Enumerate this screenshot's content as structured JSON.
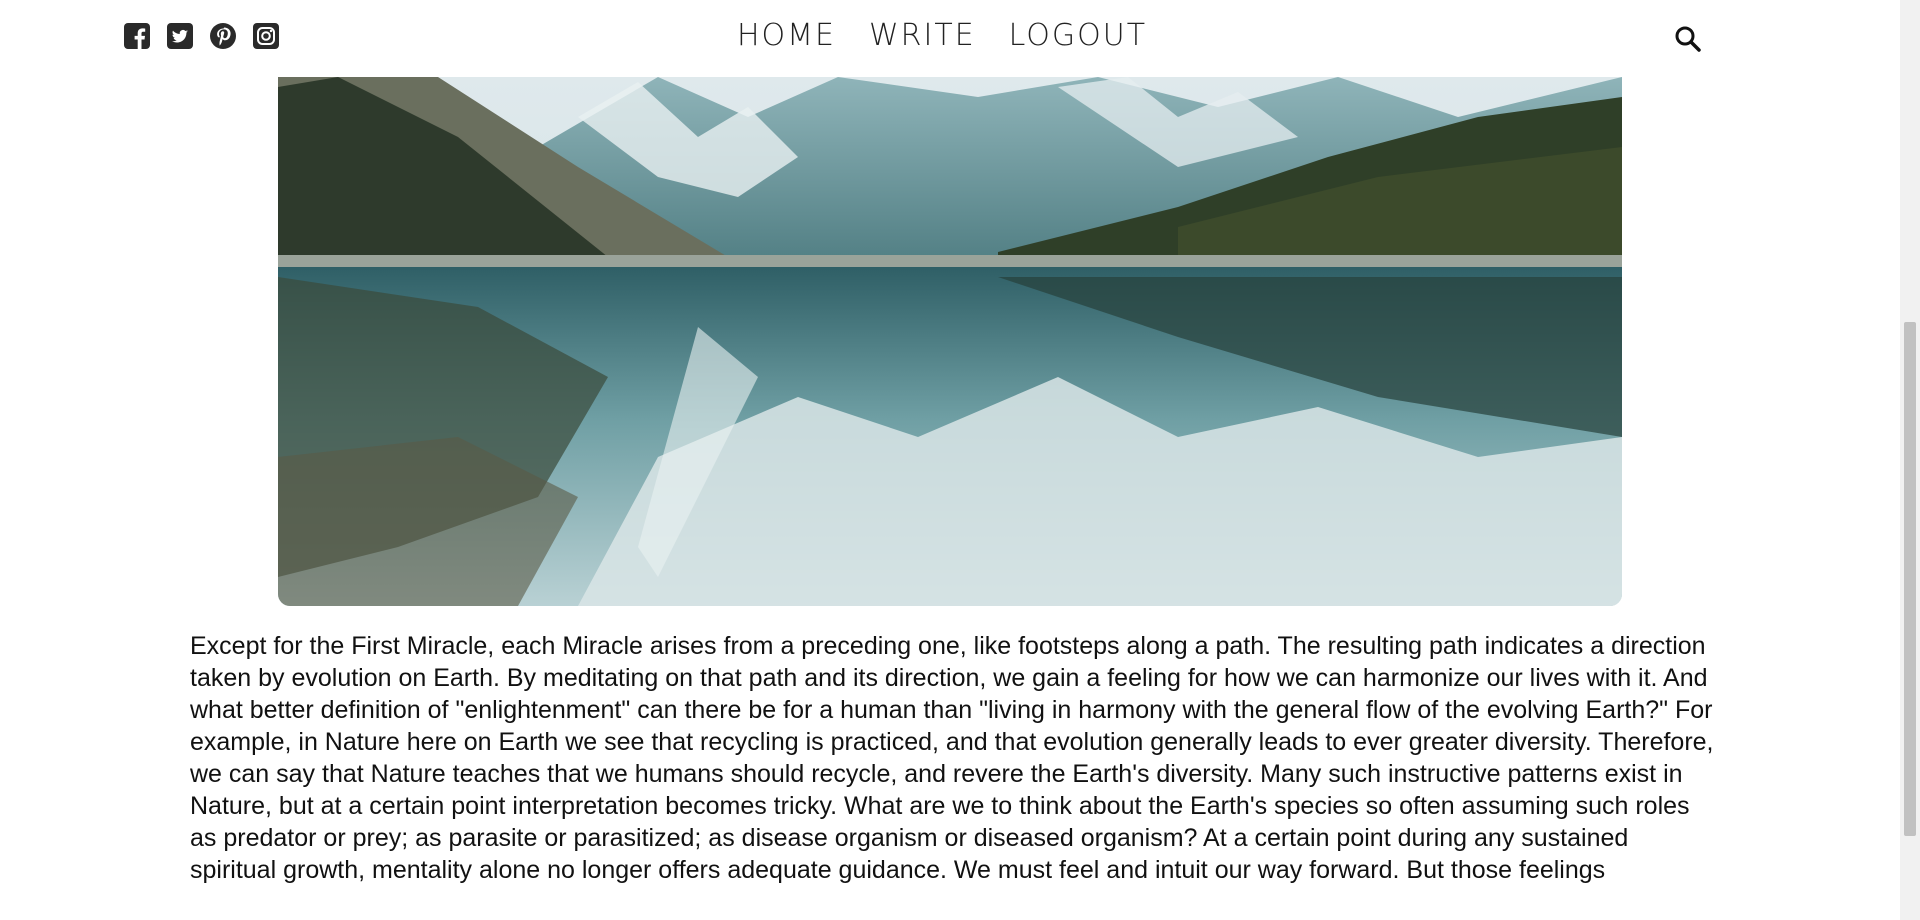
{
  "nav": {
    "home": "HOME",
    "write": "WRITE",
    "logout": "LOGOUT"
  },
  "social_icons": [
    "facebook-square-icon",
    "twitter-square-icon",
    "pinterest-icon",
    "instagram-icon"
  ],
  "search_icon": "search-icon",
  "post": {
    "image_alt": "mountain lake reflection",
    "body": "Except for the First Miracle, each Miracle arises from a preceding one, like footsteps along a path. The resulting path indicates a direction taken by evolution on Earth. By meditating on that path and its direction, we gain a feeling for how we can harmonize our lives with it. And what better definition of \"enlightenment\" can there be for a human than \"living in harmony with the general flow of the evolving Earth?\" For example, in Nature here on Earth we see that recycling is practiced, and that evolution generally leads to ever greater diversity. Therefore, we can say that Nature teaches that we humans should recycle, and revere the Earth's diversity. Many such instructive patterns exist in Nature, but at a certain point interpretation becomes tricky. What are we to think about the Earth's species so often assuming such roles as predator or prey; as parasite or parasitized; as disease organism or diseased organism? At a certain point during any sustained spiritual growth, mentality alone no longer offers adequate guidance. We must feel and intuit our way forward. But those feelings"
  },
  "colors": {
    "icon": "#222222",
    "nav_text": "#222222",
    "page_bg": "#ffffff"
  }
}
